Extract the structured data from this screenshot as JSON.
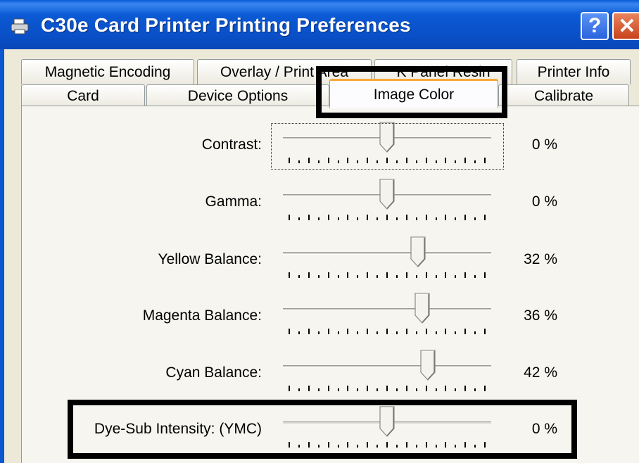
{
  "window": {
    "title": "C30e Card Printer Printing Preferences",
    "help_label": "?",
    "close_label": "✕"
  },
  "tabs": {
    "row1": [
      "Magnetic Encoding",
      "Overlay / Print Area",
      "K Panel Resin",
      "Printer Info"
    ],
    "row2": [
      "Card",
      "Device Options",
      "Image Color",
      "Calibrate"
    ],
    "selected": "Image Color"
  },
  "sliders": [
    {
      "label": "Contrast:",
      "value_text": "0 %",
      "value": 0,
      "min": -100,
      "max": 100
    },
    {
      "label": "Gamma:",
      "value_text": "0 %",
      "value": 0,
      "min": -100,
      "max": 100
    },
    {
      "label": "Yellow Balance:",
      "value_text": "32 %",
      "value": 32,
      "min": -100,
      "max": 100
    },
    {
      "label": "Magenta Balance:",
      "value_text": "36 %",
      "value": 36,
      "min": -100,
      "max": 100
    },
    {
      "label": "Cyan Balance:",
      "value_text": "42 %",
      "value": 42,
      "min": -100,
      "max": 100
    },
    {
      "label": "Dye-Sub Intensity:  (YMC)",
      "value_text": "0 %",
      "value": 0,
      "min": -100,
      "max": 100
    }
  ],
  "colors": {
    "titlebar": "#0a50c8",
    "tab_highlight": "#f7a838",
    "annotation": "#000000"
  }
}
